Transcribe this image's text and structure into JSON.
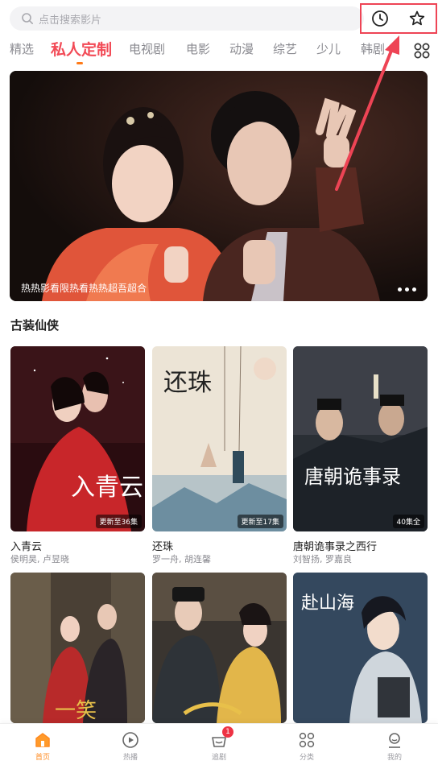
{
  "search": {
    "placeholder": "点击搜索影片"
  },
  "top_icons": {
    "history": "clock-icon",
    "favorite": "star-icon"
  },
  "tabs": [
    {
      "label": "精选",
      "active": false
    },
    {
      "label": "私人定制",
      "active": true
    },
    {
      "label": "电视剧",
      "active": false
    },
    {
      "label": "电影",
      "active": false
    },
    {
      "label": "动漫",
      "active": false
    },
    {
      "label": "综艺",
      "active": false
    },
    {
      "label": "少儿",
      "active": false
    },
    {
      "label": "韩剧",
      "active": false
    }
  ],
  "banner": {
    "caption": "热热影看限热看热热超吾超合"
  },
  "section": {
    "title": "古装仙侠"
  },
  "cards": [
    {
      "title": "入青云",
      "cast": "侯明昊, 卢昱晓",
      "badge": "更新至36集",
      "poster_text": "入青云"
    },
    {
      "title": "还珠",
      "cast": "罗一舟, 胡连馨",
      "badge": "更新至17集",
      "poster_text": "还珠"
    },
    {
      "title": "唐朝诡事录之西行",
      "cast": "刘智扬, 罗嘉良",
      "badge": "40集全",
      "poster_text": "唐朝诡事录"
    },
    {
      "title": "",
      "cast": "",
      "badge": "",
      "poster_text": "一笑"
    },
    {
      "title": "",
      "cast": "",
      "badge": "",
      "poster_text": ""
    },
    {
      "title": "",
      "cast": "",
      "badge": "",
      "poster_text": "赴山海"
    }
  ],
  "nav": {
    "items": [
      {
        "label": "首页",
        "active": true
      },
      {
        "label": "热播",
        "active": false
      },
      {
        "label": "追剧",
        "active": false,
        "badge": "1"
      },
      {
        "label": "分类",
        "active": false
      },
      {
        "label": "我的",
        "active": false
      }
    ]
  },
  "colors": {
    "accent": "#f24a56",
    "nav_active": "#ff8a1f",
    "annotation": "#ee4455"
  }
}
